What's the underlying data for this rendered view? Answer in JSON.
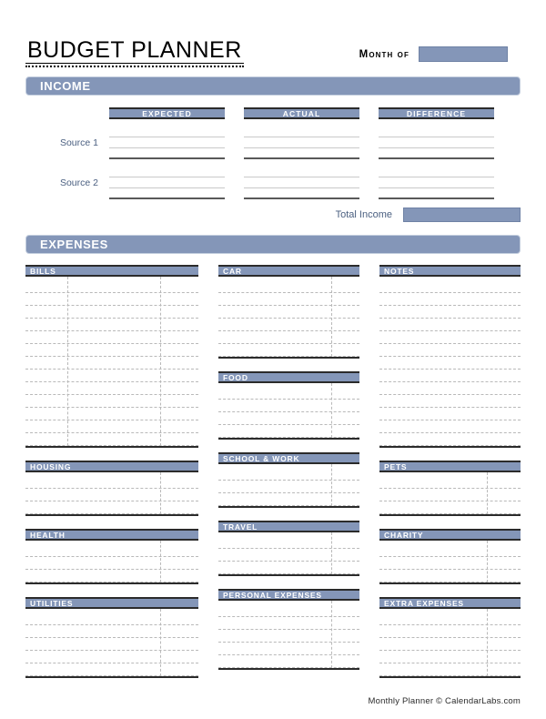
{
  "header": {
    "title": "BUDGET PLANNER",
    "month_label": "Month of",
    "month_value": ""
  },
  "income": {
    "banner": "INCOME",
    "column_headers": [
      "EXPECTED",
      "ACTUAL",
      "DIFFERENCE"
    ],
    "rows": [
      {
        "label": "Source 1",
        "expected": "",
        "actual": "",
        "difference": ""
      },
      {
        "label": "Source 2",
        "expected": "",
        "actual": "",
        "difference": ""
      }
    ],
    "total_label": "Total Income",
    "total_value": ""
  },
  "expenses": {
    "banner": "EXPENSES",
    "columns": [
      {
        "name": "left",
        "blocks": [
          {
            "title": "BILLS",
            "rows": 13,
            "rules": [
              0.24,
              0.78
            ]
          },
          {
            "title": "HOUSING",
            "rows": 3,
            "rules": [
              0.78
            ]
          },
          {
            "title": "HEALTH",
            "rows": 3,
            "rules": [
              0.78
            ]
          },
          {
            "title": "UTILITIES",
            "rows": 5,
            "rules": [
              0.78
            ]
          }
        ]
      },
      {
        "name": "middle",
        "blocks": [
          {
            "title": "CAR",
            "rows": 6,
            "rules": [
              0.8
            ]
          },
          {
            "title": "FOOD",
            "rows": 4,
            "rules": [
              0.8
            ]
          },
          {
            "title": "SCHOOL & WORK",
            "rows": 3,
            "rules": [
              0.8
            ]
          },
          {
            "title": "TRAVEL",
            "rows": 3,
            "rules": [
              0.8
            ]
          },
          {
            "title": "PERSONAL EXPENSES",
            "rows": 5,
            "rules": [
              0.8
            ]
          }
        ]
      },
      {
        "name": "right",
        "blocks": [
          {
            "title": "NOTES",
            "rows": 13,
            "rules": []
          },
          {
            "title": "PETS",
            "rows": 3,
            "rules": [
              0.76
            ]
          },
          {
            "title": "CHARITY",
            "rows": 3,
            "rules": [
              0.76
            ]
          },
          {
            "title": "EXTRA EXPENSES",
            "rows": 5,
            "rules": [
              0.76
            ]
          }
        ]
      }
    ]
  },
  "footer": {
    "text": "Monthly Planner © CalendarLabs.com"
  },
  "colors": {
    "accent_blue": "#8496b8",
    "banner_border": "#c3cede",
    "rule_dark": "#2b2b2b",
    "label_blue": "#4a5f80",
    "dash_gray": "#b9b9b9"
  }
}
